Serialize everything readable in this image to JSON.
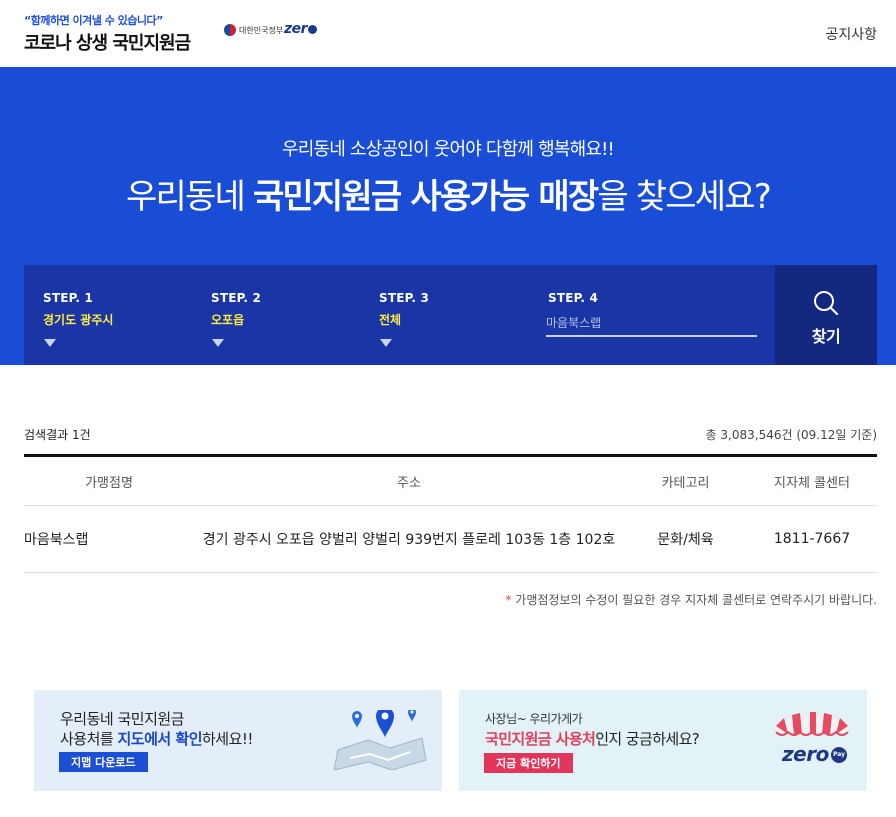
{
  "header": {
    "slogan": "“함께하면 이겨낼 수 있습니다”",
    "title": "코로나 상생 국민지원금",
    "gov_logo_text": "대한민국정부",
    "zero_logo_text": "zer",
    "notice_link": "공지사항"
  },
  "hero": {
    "subtitle": "우리동네 소상공인이 웃어야 다함께 행복해요!!",
    "title_part1": "우리동네 ",
    "title_bold": "국민지원금 사용가능 매장",
    "title_part2": "을 찾으세요?"
  },
  "search": {
    "steps": [
      {
        "label": "STEP. 1",
        "value": "경기도 광주시"
      },
      {
        "label": "STEP. 2",
        "value": "오포읍"
      },
      {
        "label": "STEP. 3",
        "value": "전체"
      }
    ],
    "step4_label": "STEP. 4",
    "keyword_placeholder": "마음북스랩",
    "button_label": "찾기"
  },
  "results": {
    "count_text": "검색결과 1건",
    "total_text": "총 3,083,546건 (09.12일 기준)",
    "columns": [
      "가맹점명",
      "주소",
      "카테고리",
      "지자체 콜센터"
    ],
    "rows": [
      {
        "name": "마음북스랩",
        "address": "경기 광주시 오포읍 양벌리 양벌리 939번지 플로레 103동 1층 102호",
        "category": "문화/체육",
        "callcenter": "1811-7667"
      }
    ],
    "footnote": "가맹점정보의 수정이 필요한 경우 지자체 콜센터로 연락주시기 바랍니다.",
    "footnote_mark": "*"
  },
  "banners": {
    "map": {
      "line1": "우리동네 국민지원금",
      "line2_a": "사용처를 ",
      "line2_strong": "지도에서 확인",
      "line2_b": "하세요!!",
      "button": "지맵 다운로드"
    },
    "zero": {
      "line1": "사장님~ 우리가게가",
      "line2_strong": "국민지원금 사용처",
      "line2_b": "인지 궁금하세요?",
      "button": "지금 확인하기",
      "logo_text": "zero",
      "pay_text": "Pay"
    }
  },
  "colors": {
    "hero_bg": "#1a4dd6",
    "search_bar_bg": "#1a35a6",
    "search_button_bg": "#13287e",
    "step_value": "#ffec40",
    "map_button": "#1b4fd4",
    "zero_button": "#e0365a"
  }
}
